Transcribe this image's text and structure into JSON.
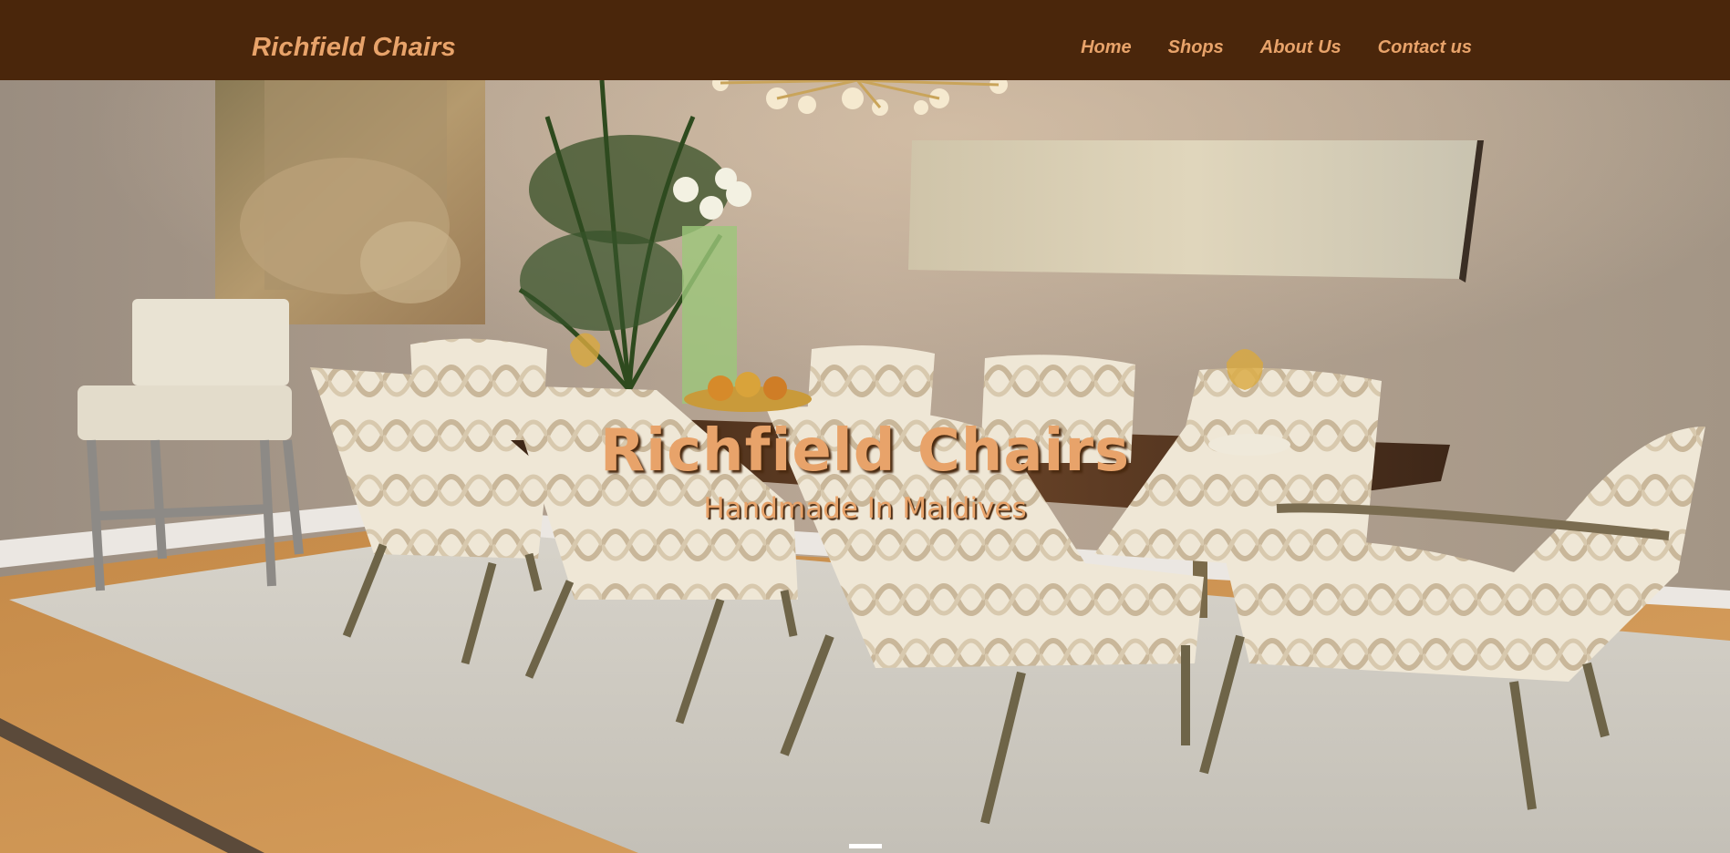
{
  "navbar": {
    "brand": "Richfield Chairs",
    "links": [
      {
        "label": "Home"
      },
      {
        "label": "Shops"
      },
      {
        "label": "About Us"
      },
      {
        "label": "Contact us"
      }
    ],
    "background_color": "#4a260b",
    "link_color": "#e8a36a"
  },
  "hero": {
    "title": "Richfield Chairs",
    "subtitle": "Handmade In Maldives",
    "text_color": "#e8a36a",
    "image_description_icon": "dining-room-photo",
    "carousel": {
      "active_index": 0,
      "count": 1
    }
  }
}
